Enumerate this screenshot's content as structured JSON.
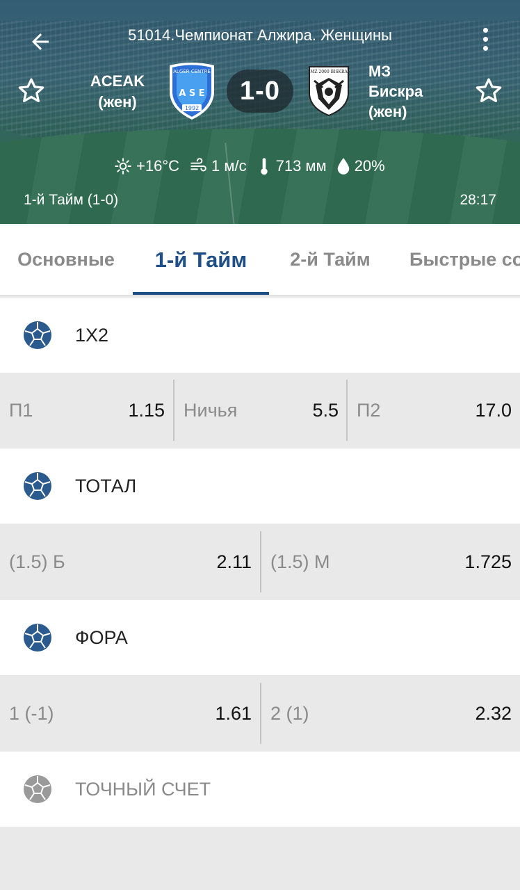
{
  "header": {
    "title": "51014.Чемпионат Алжира. Женщины",
    "team1": {
      "name_line1": "ACEAK",
      "name_line2": "(жен)",
      "logo_text_top": "ALGER CENTRE",
      "logo_text_mid": "A S E",
      "logo_year": "1992"
    },
    "team2": {
      "name_line1": "МЗ",
      "name_line2": "Бискра",
      "name_line3": "(жен)",
      "logo_text": "MZ 2000 BISKRA"
    },
    "score": "1-0",
    "weather": {
      "temperature": "+16°C",
      "wind": "1 м/с",
      "pressure": "713 мм",
      "humidity": "20%"
    },
    "period": "1-й  Тайм (1-0)",
    "clock": "28:17"
  },
  "tabs": [
    {
      "label": "Основные",
      "active": false
    },
    {
      "label": "1-й  Тайм",
      "active": true
    },
    {
      "label": "2-й  Тайм",
      "active": false
    },
    {
      "label": "Быстрые со",
      "active": false
    }
  ],
  "markets": [
    {
      "title": "1X2",
      "enabled": true,
      "odds": [
        {
          "name": "П1",
          "value": "1.15"
        },
        {
          "name": "Ничья",
          "value": "5.5"
        },
        {
          "name": "П2",
          "value": "17.0"
        }
      ]
    },
    {
      "title": "ТОТАЛ",
      "enabled": true,
      "odds": [
        {
          "name": "(1.5) Б",
          "value": "2.11"
        },
        {
          "name": "(1.5) М",
          "value": "1.725"
        }
      ]
    },
    {
      "title": "ФОРА",
      "enabled": true,
      "odds": [
        {
          "name": "1 (-1)",
          "value": "1.61"
        },
        {
          "name": "2 (1)",
          "value": "2.32"
        }
      ]
    },
    {
      "title": "ТОЧНЫЙ СЧЕТ",
      "enabled": false,
      "odds": []
    }
  ],
  "colors": {
    "accent": "#1f4f86",
    "ball_active": "#2a5a8e",
    "ball_disabled": "#9a9a9a"
  }
}
